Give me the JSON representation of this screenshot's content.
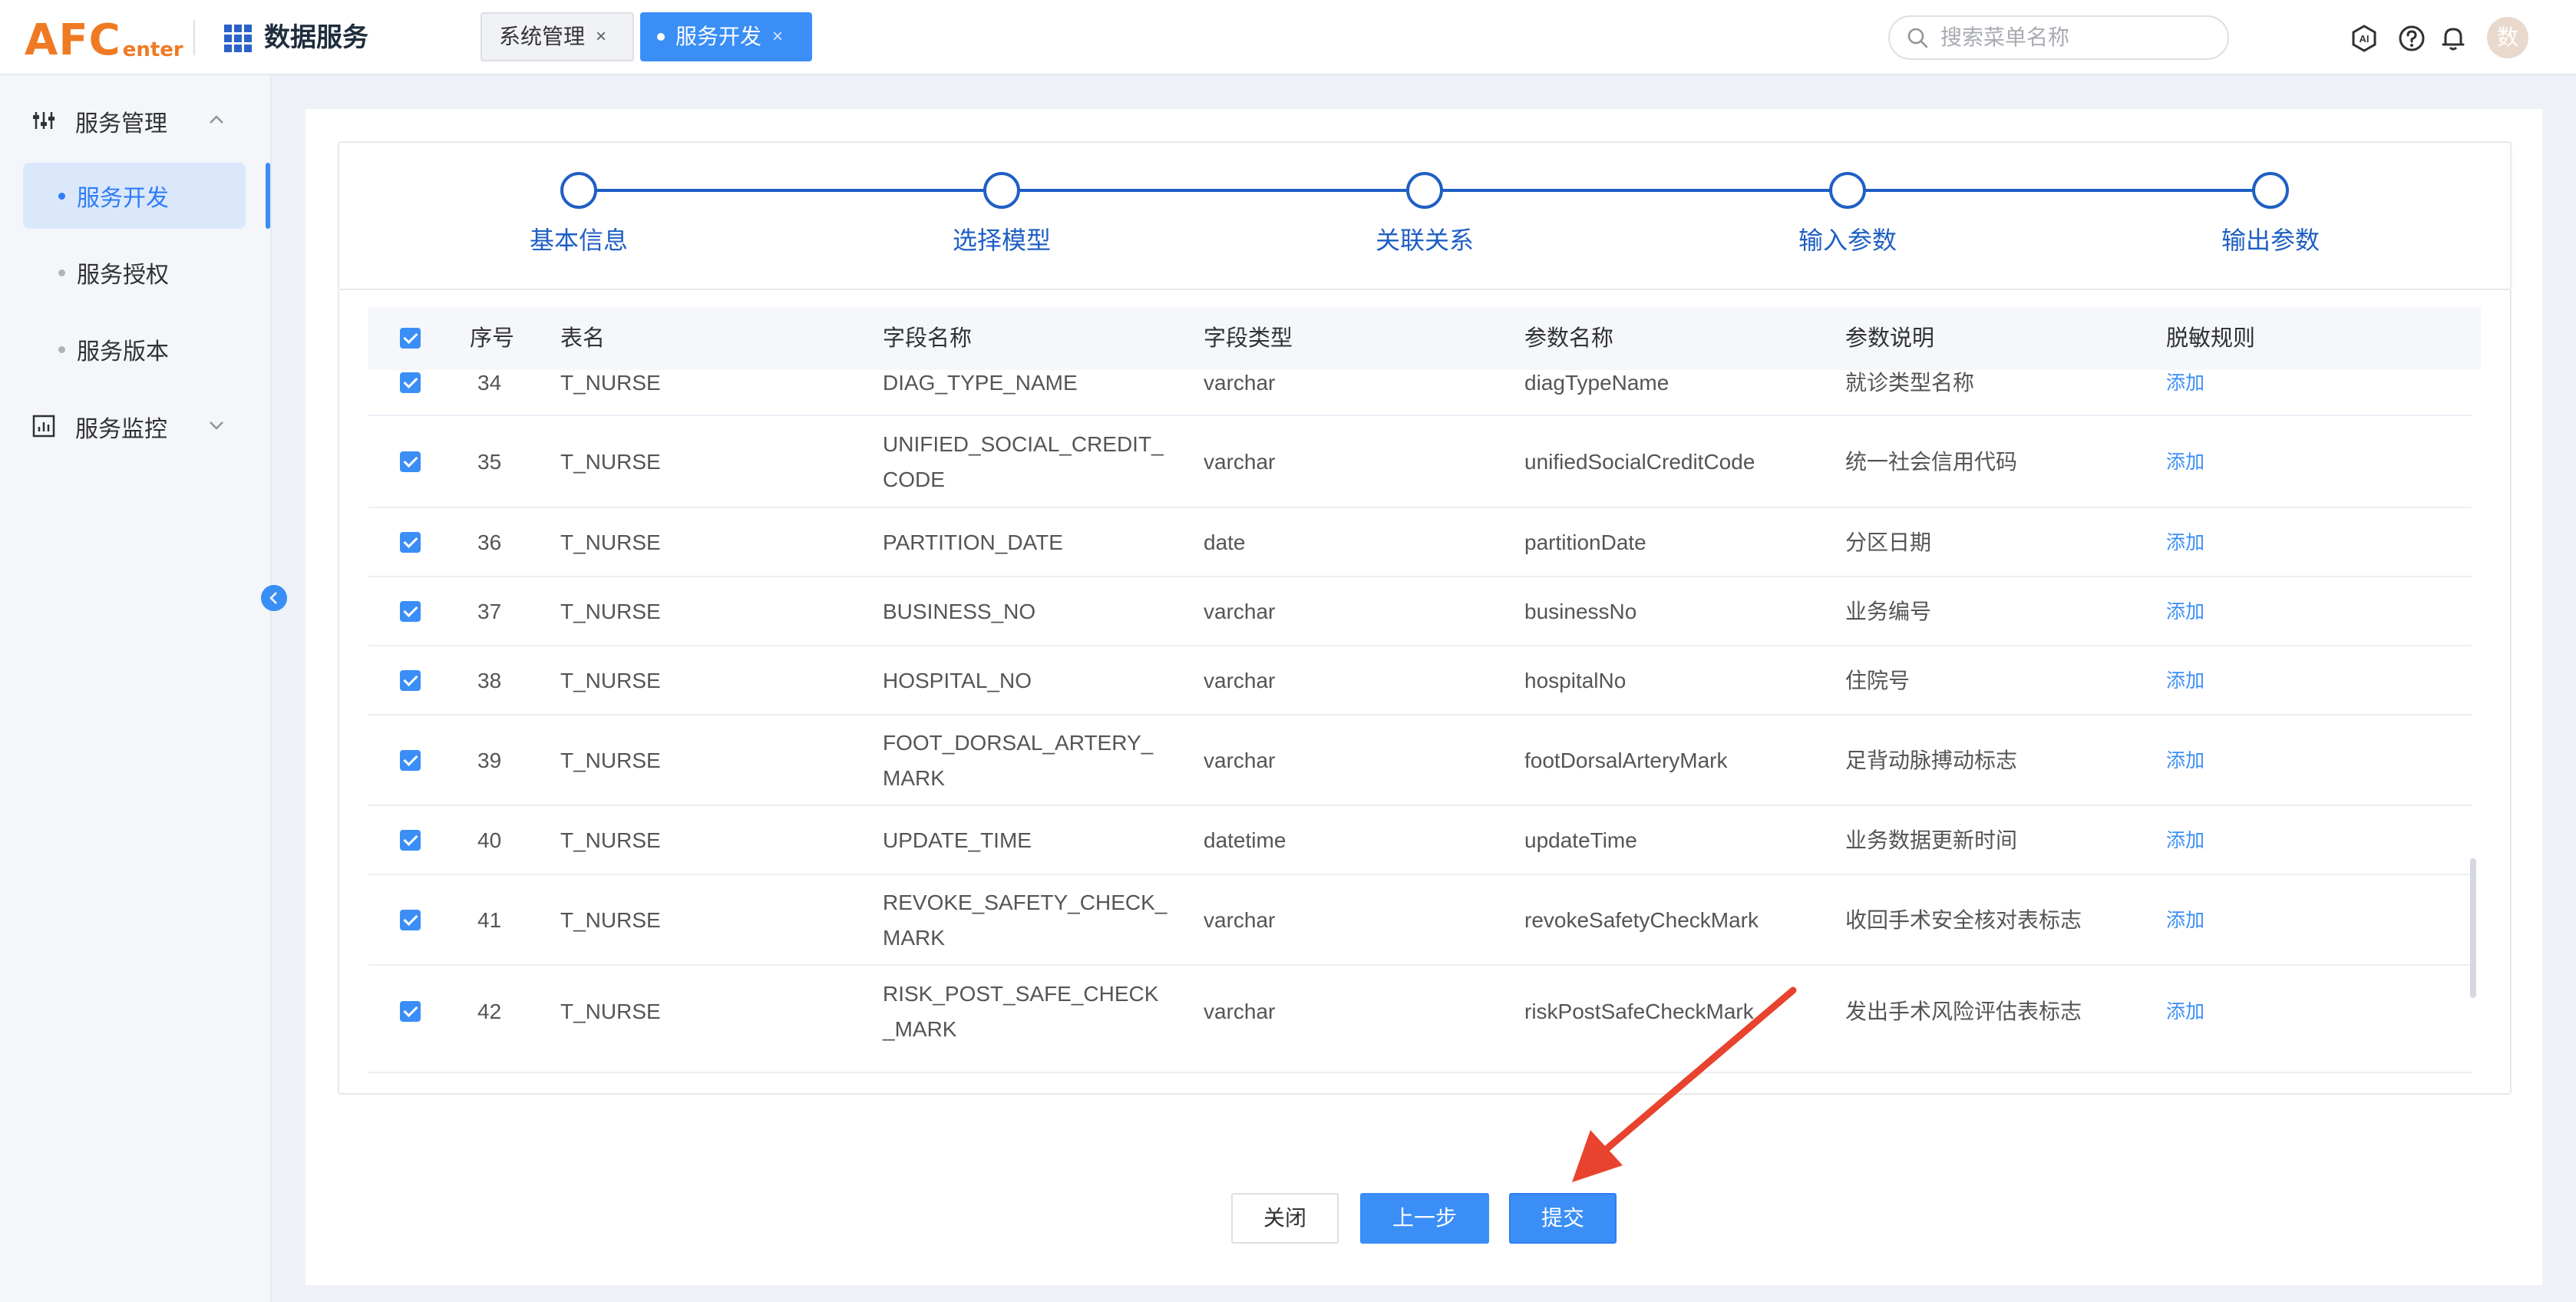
{
  "header": {
    "logo_main": "AFC",
    "logo_sub": "enter",
    "app_title": "数据服务",
    "tabs": [
      {
        "label": "系统管理",
        "close": "×"
      },
      {
        "label": "服务开发",
        "close": "×"
      }
    ],
    "search_placeholder": "搜索菜单名称",
    "avatar_text": "数",
    "icons": [
      "ai-icon",
      "help-icon",
      "bell-icon"
    ]
  },
  "sidebar": {
    "groups": [
      {
        "label": "服务管理",
        "icon": "sliders-icon",
        "expanded": true
      },
      {
        "label": "服务监控",
        "icon": "chart-icon",
        "expanded": false
      }
    ],
    "items": [
      {
        "label": "服务开发",
        "active": true
      },
      {
        "label": "服务授权",
        "active": false
      },
      {
        "label": "服务版本",
        "active": false
      }
    ]
  },
  "steps": [
    "基本信息",
    "选择模型",
    "关联关系",
    "输入参数",
    "输出参数"
  ],
  "table": {
    "columns": [
      "序号",
      "表名",
      "字段名称",
      "字段类型",
      "参数名称",
      "参数说明",
      "脱敏规则"
    ],
    "rows": [
      {
        "no": "34",
        "table": "T_NURSE",
        "field": [
          "DIAG_TYPE_NAME"
        ],
        "type": "varchar",
        "param": "diagTypeName",
        "desc": "就诊类型名称",
        "rule": "添加"
      },
      {
        "no": "35",
        "table": "T_NURSE",
        "field": [
          "UNIFIED_SOCIAL_CREDIT_",
          "CODE"
        ],
        "type": "varchar",
        "param": "unifiedSocialCreditCode",
        "desc": "统一社会信用代码",
        "rule": "添加"
      },
      {
        "no": "36",
        "table": "T_NURSE",
        "field": [
          "PARTITION_DATE"
        ],
        "type": "date",
        "param": "partitionDate",
        "desc": "分区日期",
        "rule": "添加"
      },
      {
        "no": "37",
        "table": "T_NURSE",
        "field": [
          "BUSINESS_NO"
        ],
        "type": "varchar",
        "param": "businessNo",
        "desc": "业务编号",
        "rule": "添加"
      },
      {
        "no": "38",
        "table": "T_NURSE",
        "field": [
          "HOSPITAL_NO"
        ],
        "type": "varchar",
        "param": "hospitalNo",
        "desc": "住院号",
        "rule": "添加"
      },
      {
        "no": "39",
        "table": "T_NURSE",
        "field": [
          "FOOT_DORSAL_ARTERY_",
          "MARK"
        ],
        "type": "varchar",
        "param": "footDorsalArteryMark",
        "desc": "足背动脉搏动标志",
        "rule": "添加"
      },
      {
        "no": "40",
        "table": "T_NURSE",
        "field": [
          "UPDATE_TIME"
        ],
        "type": "datetime",
        "param": "updateTime",
        "desc": "业务数据更新时间",
        "rule": "添加"
      },
      {
        "no": "41",
        "table": "T_NURSE",
        "field": [
          "REVOKE_SAFETY_CHECK_",
          "MARK"
        ],
        "type": "varchar",
        "param": "revokeSafetyCheckMark",
        "desc": "收回手术安全核对表标志",
        "rule": "添加"
      },
      {
        "no": "42",
        "table": "T_NURSE",
        "field": [
          "RISK_POST_SAFE_CHECK",
          "_MARK"
        ],
        "type": "varchar",
        "param": "riskPostSafeCheckMark",
        "desc": "发出手术风险评估表标志",
        "rule": "添加"
      }
    ]
  },
  "buttons": {
    "close": "关闭",
    "prev": "上一步",
    "submit": "提交"
  },
  "colors": {
    "accent": "#3a8ef6",
    "step": "#1f5fc4",
    "logo": "#f07a24",
    "annotation_arrow": "#e8432e"
  }
}
